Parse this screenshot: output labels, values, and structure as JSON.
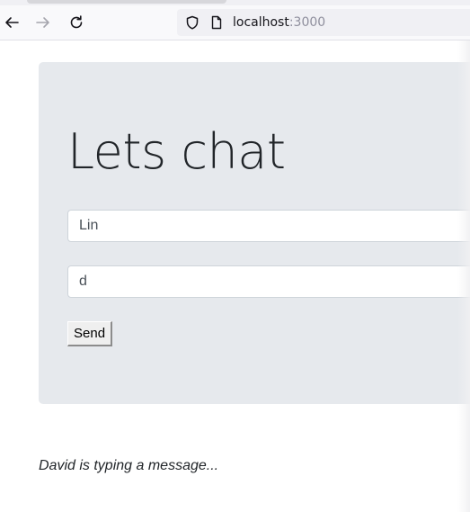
{
  "browser": {
    "url_host": "localhost",
    "url_port": ":3000"
  },
  "page": {
    "title": "Lets chat",
    "name_value": "Lin",
    "message_value": "d",
    "send_label": "Send",
    "typing_status": "David is typing a message..."
  }
}
